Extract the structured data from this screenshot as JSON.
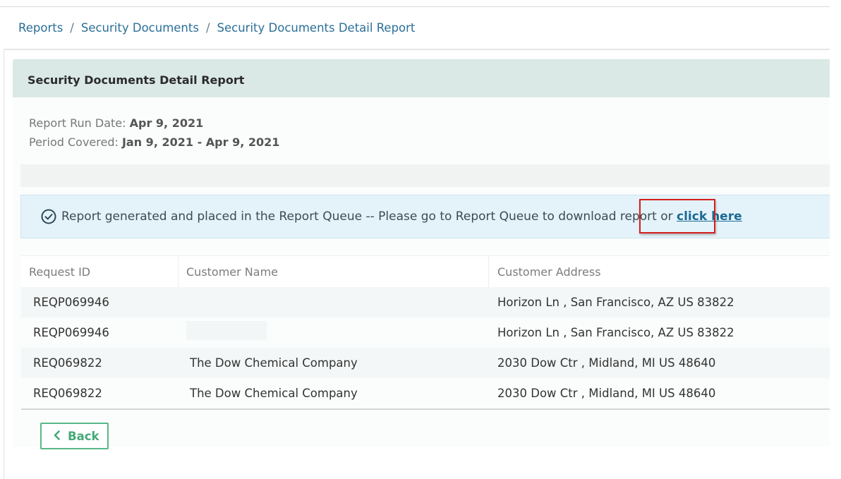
{
  "breadcrumb": {
    "items": [
      "Reports",
      "Security Documents",
      "Security Documents Detail Report"
    ],
    "separator": "/"
  },
  "panel": {
    "title": "Security Documents Detail Report"
  },
  "report_meta": {
    "run_date_label": "Report Run Date:",
    "run_date_value": "Apr 9, 2021",
    "period_label": "Period Covered:",
    "period_value": "Jan 9, 2021 - Apr 9, 2021"
  },
  "alert": {
    "icon": "check-circle-icon",
    "message": "Report generated and placed in the Report Queue -- Please go to Report Queue to download report or",
    "link_text": "click here"
  },
  "table": {
    "columns": [
      "Request ID",
      "Customer Name",
      "Customer Address"
    ],
    "rows": [
      {
        "request_id": "REQP069946",
        "customer_name": "",
        "customer_address": "Horizon Ln , San Francisco,  AZ  US 83822"
      },
      {
        "request_id": "REQP069946",
        "customer_name": "",
        "customer_address": "Horizon Ln , San Francisco,  AZ  US 83822"
      },
      {
        "request_id": "REQ069822",
        "customer_name": "The Dow Chemical Company",
        "customer_address": "2030 Dow Ctr , Midland,  MI  US 48640"
      },
      {
        "request_id": "REQ069822",
        "customer_name": "The Dow Chemical Company",
        "customer_address": "2030 Dow Ctr , Midland,  MI  US 48640"
      }
    ]
  },
  "back_button": {
    "label": "Back",
    "icon": "chevron-left-icon"
  },
  "colors": {
    "link": "#2a6f97",
    "header_bg": "#dbe9e6",
    "alert_bg": "#e4f3f9",
    "highlight": "#d51e1e",
    "back_button": "#58b889"
  }
}
